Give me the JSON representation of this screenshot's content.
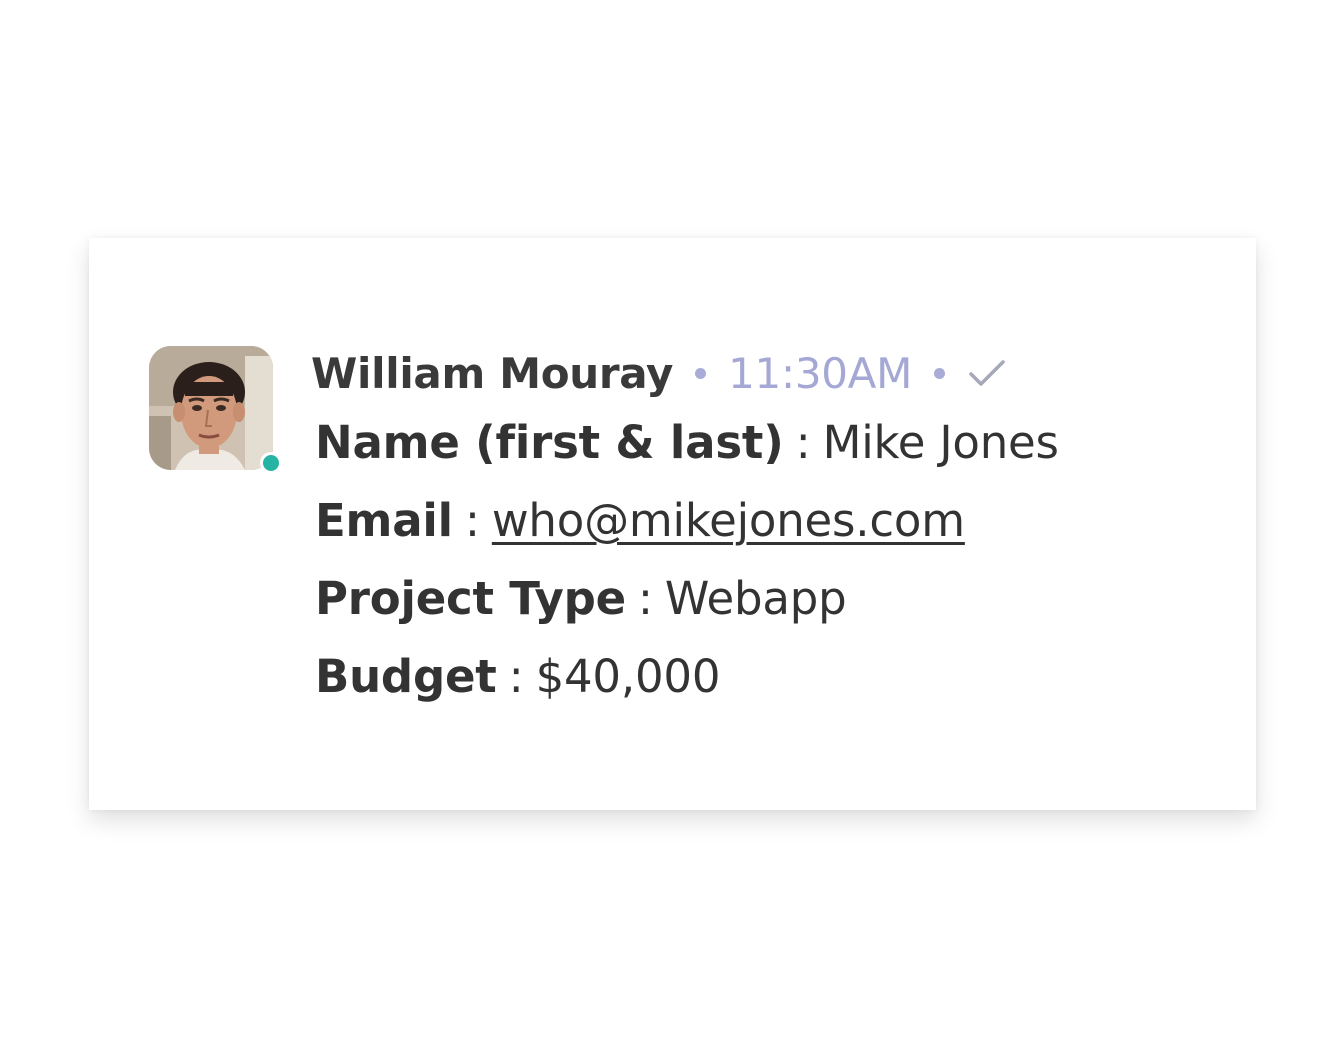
{
  "message": {
    "sender": "William Mouray",
    "timestamp": "11:30AM",
    "status_icon": "checkmark-icon",
    "presence": "online",
    "colors": {
      "sender": "#3a3a3a",
      "timestamp": "#a5a8d4",
      "presence": "#25b3a3",
      "check": "#a5a8b8"
    },
    "fields": [
      {
        "label": "Name (first & last)",
        "separator": ":",
        "value": "Mike Jones"
      },
      {
        "label": "Email",
        "separator": ":",
        "value": "who@mikejones.com"
      },
      {
        "label": "Project Type",
        "separator": ":",
        "value": "Webapp"
      },
      {
        "label": "Budget",
        "separator": ":",
        "value": "$40,000"
      }
    ]
  }
}
